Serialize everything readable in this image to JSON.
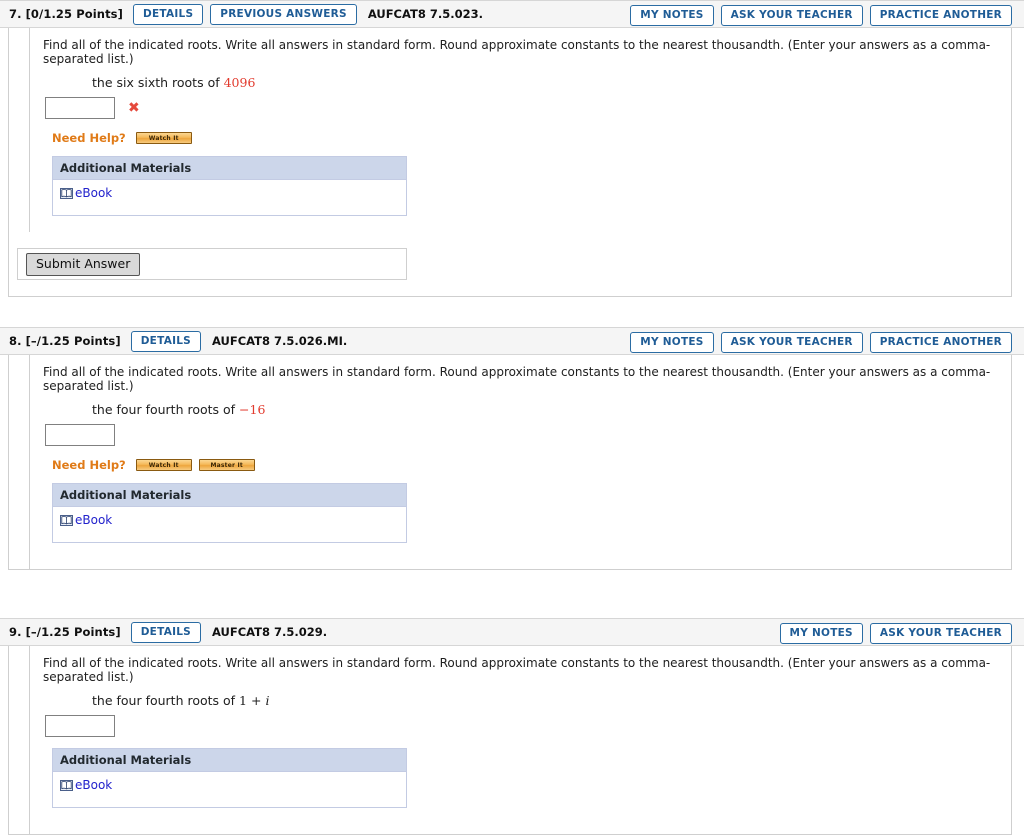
{
  "common": {
    "prompt": "Find all of the indicated roots. Write all answers in standard form. Round approximate constants to the nearest thousandth. (Enter your answers as a comma-separated list.)",
    "need_help_label": "Need Help?",
    "watch_it_label": "Watch It",
    "master_it_label": "Master It",
    "additional_materials_title": "Additional Materials",
    "ebook_label": "eBook",
    "details_label": "DETAILS",
    "previous_answers_label": "PREVIOUS ANSWERS",
    "my_notes_label": "MY NOTES",
    "ask_your_teacher_label": "ASK YOUR TEACHER",
    "practice_another_label": "PRACTICE ANOTHER",
    "submit_answer_label": "Submit Answer",
    "incorrect_mark": "✖",
    "answer_placeholder": "",
    "ebook_icon": "open-book-icon",
    "accent_blue": "#1f5c96",
    "accent_orange": "#e07b18",
    "error_red": "#e23b2e",
    "header_bg": "#f5f5f5",
    "panel_header_bg": "#ccd6ea"
  },
  "questions": [
    {
      "index": "7.",
      "points": "[0/1.25 Points]",
      "tag": "AUFCAT8 7.5.023.",
      "answer_value": "",
      "math_prefix": "the six sixth roots of ",
      "math_value": "4096",
      "math_value_red": true,
      "status": "incorrect"
    },
    {
      "index": "8.",
      "points": "[–/1.25 Points]",
      "tag": "AUFCAT8 7.5.026.MI.",
      "answer_value": "",
      "math_prefix": "the four fourth roots of ",
      "math_value": "−16",
      "math_value_red": true,
      "status": "unanswered"
    },
    {
      "index": "9.",
      "points": "[–/1.25 Points]",
      "tag": "AUFCAT8 7.5.029.",
      "answer_value": "",
      "math_prefix": "the four fourth roots of ",
      "math_value": "1 + i",
      "math_value_red": false,
      "status": "unanswered"
    }
  ]
}
